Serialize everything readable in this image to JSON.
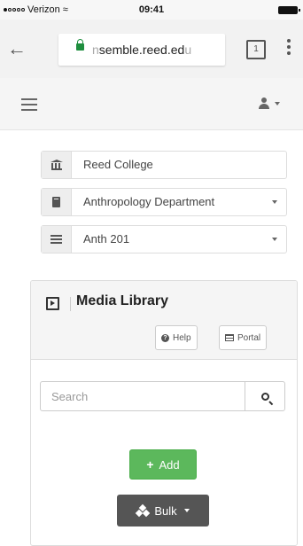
{
  "status_bar": {
    "carrier": "Verizon",
    "time": "09:41"
  },
  "browser": {
    "url_faded": "n",
    "url_main": "semble.reed.ed",
    "url_tail": "u",
    "tab_count": "1"
  },
  "selectors": {
    "institution": "Reed College",
    "department": "Anthropology Department",
    "course": "Anth 201"
  },
  "panel": {
    "title": "Media Library",
    "help_label": "Help",
    "portal_label": "Portal",
    "search_placeholder": "Search",
    "add_label": "Add",
    "bulk_label": "Bulk"
  }
}
